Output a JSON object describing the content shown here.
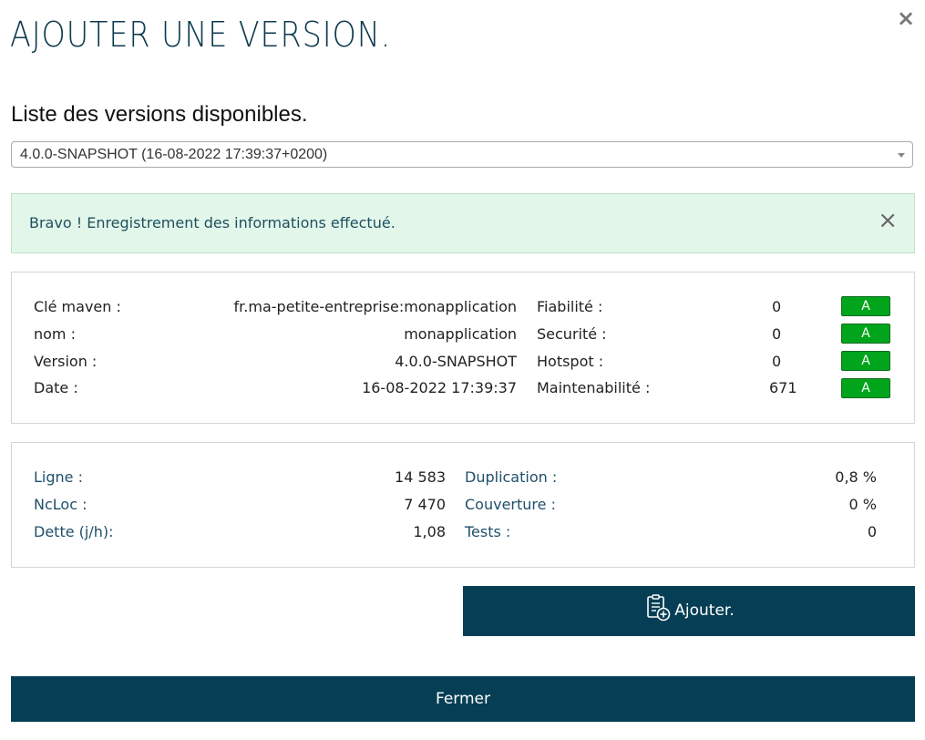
{
  "dialog": {
    "title": "AJOUTER UNE VERSION.",
    "close_symbol": "×"
  },
  "versions": {
    "heading": "Liste des versions disponibles.",
    "selected": "4.0.0-SNAPSHOT (16-08-2022 17:39:37+0200)"
  },
  "alert": {
    "message": "Bravo ! Enregistrement des informations effectué.",
    "close_symbol": "×"
  },
  "project": {
    "key_label": "Clé maven :",
    "key_value": "fr.ma-petite-entreprise:monapplication",
    "name_label": "nom :",
    "name_value": "monapplication",
    "version_label": "Version :",
    "version_value": "4.0.0-SNAPSHOT",
    "date_label": "Date :",
    "date_value": "16-08-2022 17:39:37"
  },
  "ratings": [
    {
      "label": "Fiabilité :",
      "value": "0",
      "grade": "A"
    },
    {
      "label": "Securité :",
      "value": "0",
      "grade": "A"
    },
    {
      "label": "Hotspot :",
      "value": "0",
      "grade": "A"
    },
    {
      "label": "Maintenabilité :",
      "value": "671",
      "grade": "A"
    }
  ],
  "metrics_left": [
    {
      "label": "Ligne :",
      "value": "14 583"
    },
    {
      "label": "NcLoc :",
      "value": "7 470"
    },
    {
      "label": "Dette (j/h):",
      "value": "1,08"
    }
  ],
  "metrics_right": [
    {
      "label": "Duplication :",
      "value": "0,8 %"
    },
    {
      "label": "Couverture :",
      "value": "0 %"
    },
    {
      "label": "Tests :",
      "value": "0"
    }
  ],
  "actions": {
    "add_label": "Ajouter.",
    "close_label": "Fermer"
  },
  "colors": {
    "primary": "#063f55",
    "badge_green": "#00a51b",
    "alert_bg": "#e2f7ea"
  },
  "icons": {
    "add": "clipboard-add-icon",
    "dropdown": "chevron-down-icon",
    "close": "close-icon"
  }
}
